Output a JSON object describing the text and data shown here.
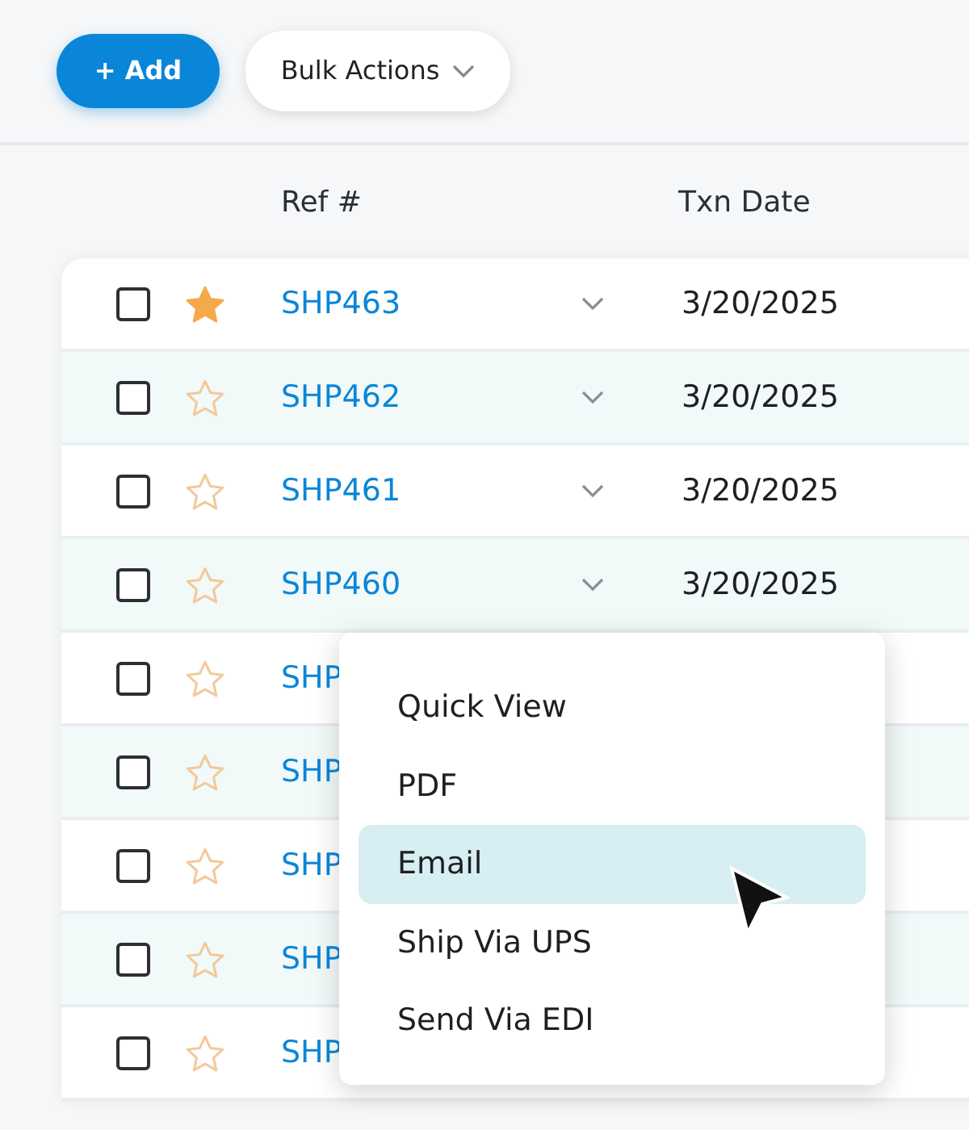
{
  "toolbar": {
    "add_button": "+ Add",
    "bulk_actions": "Bulk Actions"
  },
  "table": {
    "columns": [
      "Ref #",
      "Txn Date"
    ],
    "rows": [
      {
        "checked": false,
        "starred": true,
        "ref": "SHP463",
        "date": "3/20/2025"
      },
      {
        "checked": false,
        "starred": false,
        "ref": "SHP462",
        "date": "3/20/2025"
      },
      {
        "checked": false,
        "starred": false,
        "ref": "SHP461",
        "date": "3/20/2025"
      },
      {
        "checked": false,
        "starred": false,
        "ref": "SHP460",
        "date": "3/20/2025"
      },
      {
        "checked": false,
        "starred": false,
        "ref": "SHP"
      },
      {
        "checked": false,
        "starred": false,
        "ref": "SHP"
      },
      {
        "checked": false,
        "starred": false,
        "ref": "SHP"
      },
      {
        "checked": false,
        "starred": false,
        "ref": "SHP"
      },
      {
        "checked": false,
        "starred": false,
        "ref": "SHP"
      }
    ]
  },
  "row_menu": {
    "items": [
      {
        "label": "Quick View",
        "selected": false
      },
      {
        "label": "PDF",
        "selected": false
      },
      {
        "label": "Email",
        "selected": true
      },
      {
        "label": "Ship Via UPS",
        "selected": false
      },
      {
        "label": "Send Via EDI",
        "selected": false
      }
    ]
  }
}
